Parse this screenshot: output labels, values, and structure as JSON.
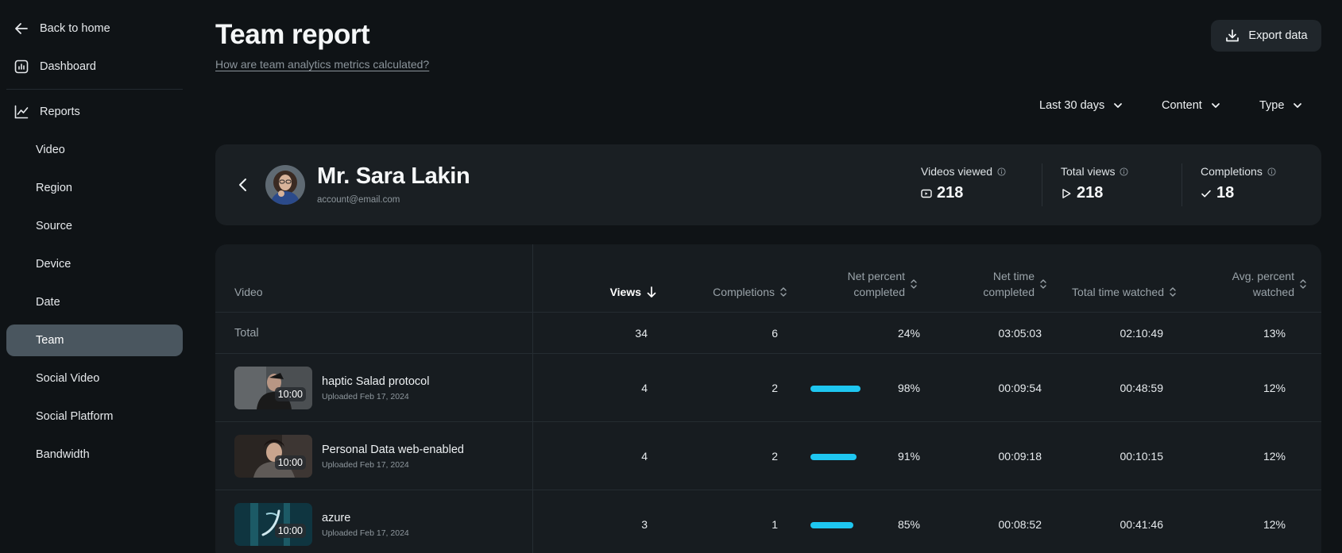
{
  "sidebar": {
    "back_label": "Back to home",
    "dashboard_label": "Dashboard",
    "reports_label": "Reports",
    "items": [
      {
        "label": "Video"
      },
      {
        "label": "Region"
      },
      {
        "label": "Source"
      },
      {
        "label": "Device"
      },
      {
        "label": "Date"
      },
      {
        "label": "Team",
        "active": true
      },
      {
        "label": "Social Video"
      },
      {
        "label": "Social Platform"
      },
      {
        "label": "Bandwidth"
      }
    ]
  },
  "header": {
    "title": "Team report",
    "help_link": "How are team analytics metrics calculated?",
    "export_label": "Export data"
  },
  "filters": {
    "range": "Last 30 days",
    "content": "Content",
    "type": "Type"
  },
  "profile": {
    "name": "Mr. Sara Lakin",
    "email": "account@email.com",
    "stats": [
      {
        "label": "Videos viewed",
        "value": "218",
        "icon": "video-icon"
      },
      {
        "label": "Total views",
        "value": "218",
        "icon": "play-icon"
      },
      {
        "label": "Completions",
        "value": "18",
        "icon": "check-icon"
      }
    ]
  },
  "table": {
    "columns": {
      "video": "Video",
      "views": "Views",
      "completions": "Completions",
      "net_percent_line1": "Net percent",
      "net_percent_line2": "completed",
      "net_time_line1": "Net time",
      "net_time_line2": "completed",
      "total_time": "Total time watched",
      "avg_percent_line1": "Avg. percent",
      "avg_percent_line2": "watched"
    },
    "total": {
      "label": "Total",
      "views": "34",
      "completions": "6",
      "net_percent": "24%",
      "net_time": "03:05:03",
      "total_time": "02:10:49",
      "avg_percent": "13%"
    },
    "rows": [
      {
        "title": "haptic Salad protocol",
        "uploaded": "Uploaded Feb 17, 2024",
        "duration": "10:00",
        "views": "4",
        "completions": "2",
        "net_percent": "98%",
        "net_percent_value": 98,
        "net_time": "00:09:54",
        "total_time": "00:48:59",
        "avg_percent": "12%"
      },
      {
        "title": "Personal Data web-enabled",
        "uploaded": "Uploaded Feb 17, 2024",
        "duration": "10:00",
        "views": "4",
        "completions": "2",
        "net_percent": "91%",
        "net_percent_value": 91,
        "net_time": "00:09:18",
        "total_time": "00:10:15",
        "avg_percent": "12%"
      },
      {
        "title": "azure",
        "uploaded": "Uploaded Feb 17, 2024",
        "duration": "10:00",
        "views": "3",
        "completions": "1",
        "net_percent": "85%",
        "net_percent_value": 85,
        "net_time": "00:08:52",
        "total_time": "00:41:46",
        "avg_percent": "12%"
      }
    ]
  },
  "colors": {
    "background": "#0f1316",
    "card": "#1a1f23",
    "active_nav": "#4a565f",
    "progress": "#1ec6f0"
  }
}
